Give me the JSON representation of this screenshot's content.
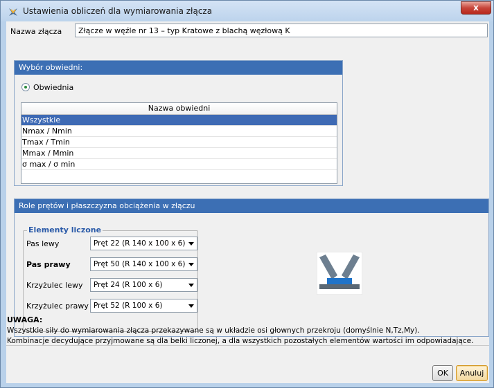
{
  "window": {
    "title": "Ustawienia obliczeń dla wymiarowania złącza",
    "close_label": "x"
  },
  "name_field": {
    "label": "Nazwa złącza",
    "value": "Złącze w węźle nr 13 – typ Kratowe z blachą węzłową K"
  },
  "envelope_panel": {
    "title": "Wybór obwiedni:",
    "radio_label": "Obwiednia",
    "radio_selected": true,
    "list_header": "Nazwa obwiedni",
    "items": [
      "Wszystkie",
      "Nmax / Nmin",
      "Tmax / Tmin",
      "Mmax / Mmin",
      "σ max / σ min"
    ],
    "selected_index": 0
  },
  "roles_panel": {
    "title": "Role prętów i płaszczyzna obciążenia w złączu",
    "group_title": "Elementy liczone",
    "rows": [
      {
        "label": "Pas lewy",
        "value": "Pręt 22 (R 140 x 100 x 6)"
      },
      {
        "label": "Pas prawy",
        "value": "Pręt 50 (R 140 x 100 x 6)"
      },
      {
        "label": "Krzyżulec lewy",
        "value": "Pręt 24 (R 100 x 6)"
      },
      {
        "label": "Krzyżulec prawy",
        "value": "Pręt 52 (R 100 x 6)"
      }
    ],
    "joint_icon": "truss-joint-icon"
  },
  "note": {
    "title": "UWAGA:",
    "line1": "Wszystkie siły do wymiarowania złącza przekazywane są w układzie osi głownych przekroju (domyślnie N,Tz,My).",
    "line2": "Kombinacje decydujące przyjmowane są dla belki liczonej, a dla wszystkich pozostałych elementów wartości im odpowiadające."
  },
  "buttons": {
    "ok": "OK",
    "cancel": "Anuluj"
  },
  "colors": {
    "panel_header": "#3c6fb4",
    "selection": "#3e6ab4",
    "group_title": "#2a5aa8"
  }
}
